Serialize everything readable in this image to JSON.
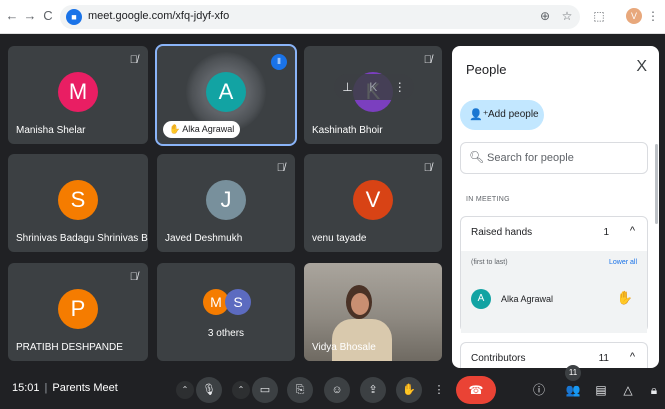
{
  "browser": {
    "url": "meet.google.com/xfq-jdyf-xfo",
    "back_icon": "←",
    "forward_icon": "→",
    "reload_icon": "C",
    "zoom_icon": "⊕",
    "star_icon": "☆",
    "extension_icon": "⬚",
    "profile_initial": "V",
    "menu_icon": "⋮"
  },
  "tiles": [
    {
      "name": "Manisha Shelar",
      "initial": "M",
      "color": "#e91e63",
      "muted": true
    },
    {
      "name": "Alka Agrawal",
      "initial": "A",
      "color": "#12a3a3",
      "speaking": true
    },
    {
      "name": "Kashinath Bhoir",
      "initial": "K",
      "color": "#7b3fbf",
      "muted": true
    },
    {
      "name": "Shrinivas Badagu Shrinivas Ba...",
      "initial": "S",
      "color": "#f57c00",
      "muted": false
    },
    {
      "name": "Javed Deshmukh",
      "initial": "J",
      "color": "#78909c",
      "muted": true
    },
    {
      "name": "venu tayade",
      "initial": "V",
      "color": "#d84315",
      "muted": true
    },
    {
      "name": "PRATIBH DESHPANDE",
      "initial": "P",
      "color": "#f57c00",
      "muted": true
    },
    {
      "name": "3 others",
      "initials": [
        "M",
        "S"
      ],
      "colors": [
        "#f57c00",
        "#5c6bc0"
      ]
    },
    {
      "name": "Vidya Bhosale"
    }
  ],
  "icons": {
    "mute": "🎙̸",
    "speaking": "⦀",
    "hand": "✋",
    "pin": "⊥",
    "more": "⋮"
  },
  "panel": {
    "title": "People",
    "close": "X",
    "add_people": "Add people",
    "search_placeholder": "Search for people",
    "in_meeting": "IN MEETING",
    "raised_hands": {
      "label": "Raised hands",
      "count": "1",
      "chevron": "^",
      "sub": "(first to last)",
      "lower_all": "Lower all",
      "person": {
        "name": "Alka Agrawal",
        "initial": "A"
      }
    },
    "contributors": {
      "label": "Contributors",
      "count": "11",
      "chevron": "^"
    }
  },
  "bottom": {
    "time": "15:01",
    "meeting_name": "Parents Meet",
    "people_count": "11"
  }
}
